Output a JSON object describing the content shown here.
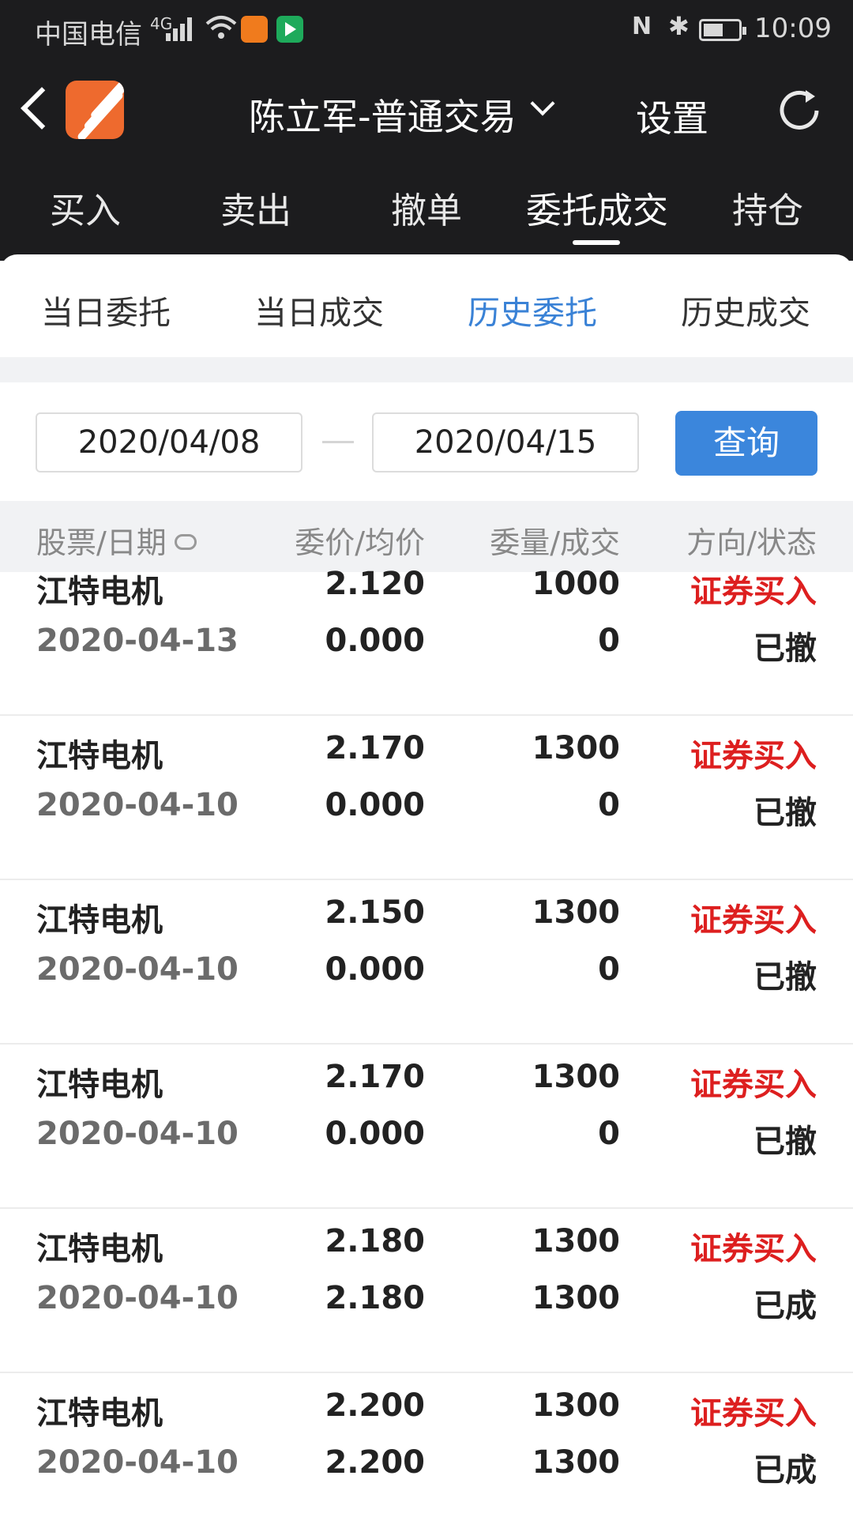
{
  "status_bar": {
    "carrier": "中国电信",
    "signal_tag": "4G",
    "time": "10:09",
    "nfc": "N",
    "icons": [
      "signal-icon",
      "wifi-icon",
      "uc-browser-icon",
      "video-app-icon",
      "nfc-icon",
      "bluetooth-icon",
      "battery-icon"
    ]
  },
  "navbar": {
    "title": "陈立军-普通交易",
    "settings_label": "设置",
    "colors": {
      "bg": "#1c1c1e",
      "logo": "#ee6a2e"
    }
  },
  "main_tabs": [
    {
      "label": "买入"
    },
    {
      "label": "卖出"
    },
    {
      "label": "撤单"
    },
    {
      "label": "委托成交",
      "active": true
    },
    {
      "label": "持仓"
    }
  ],
  "sub_tabs": [
    {
      "label": "当日委托"
    },
    {
      "label": "当日成交"
    },
    {
      "label": "历史委托",
      "active": true
    },
    {
      "label": "历史成交"
    }
  ],
  "date_filter": {
    "start": "2020/04/08",
    "end": "2020/04/15",
    "query_label": "查询",
    "accent": "#3b86dc"
  },
  "table": {
    "headers": [
      "股票/日期",
      "委价/均价",
      "委量/成交",
      "方向/状态"
    ],
    "rows": [
      {
        "name": "江特电机",
        "date": "2020-04-13",
        "price": "2.120",
        "avg": "0.000",
        "qty": "1000",
        "filled": "0",
        "direction": "证券买入",
        "status": "已撤"
      },
      {
        "name": "江特电机",
        "date": "2020-04-10",
        "price": "2.170",
        "avg": "0.000",
        "qty": "1300",
        "filled": "0",
        "direction": "证券买入",
        "status": "已撤"
      },
      {
        "name": "江特电机",
        "date": "2020-04-10",
        "price": "2.150",
        "avg": "0.000",
        "qty": "1300",
        "filled": "0",
        "direction": "证券买入",
        "status": "已撤"
      },
      {
        "name": "江特电机",
        "date": "2020-04-10",
        "price": "2.170",
        "avg": "0.000",
        "qty": "1300",
        "filled": "0",
        "direction": "证券买入",
        "status": "已撤"
      },
      {
        "name": "江特电机",
        "date": "2020-04-10",
        "price": "2.180",
        "avg": "2.180",
        "qty": "1300",
        "filled": "1300",
        "direction": "证券买入",
        "status": "已成"
      },
      {
        "name": "江特电机",
        "date": "2020-04-10",
        "price": "2.200",
        "avg": "2.200",
        "qty": "1300",
        "filled": "1300",
        "direction": "证券买入",
        "status": "已成"
      }
    ],
    "direction_color": "#dd1f1f"
  }
}
